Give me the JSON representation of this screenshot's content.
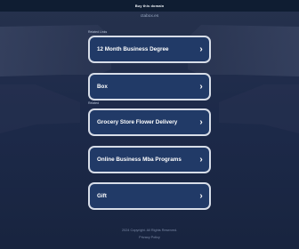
{
  "topbar": {
    "button_label": "Buy this domain"
  },
  "domain": "ctabox.es",
  "links_label": "Related Links",
  "related_label": "Related",
  "links": [
    {
      "label": "12 Month Business Degree"
    },
    {
      "label": "Box"
    },
    {
      "label": "Grocery Store Flower Delivery"
    },
    {
      "label": "Online Business Mba Programs"
    },
    {
      "label": "Gift"
    }
  ],
  "footer": {
    "line1": "2024 Copyright. All Rights Reserved.",
    "line2": "Privacy Policy"
  },
  "colors": {
    "background": "#1d2a4a",
    "topbar": "#0f1d32",
    "card": "#213a67",
    "card_border": "#d7dde8"
  },
  "icons": {
    "chevron": "chevron-right-icon"
  }
}
